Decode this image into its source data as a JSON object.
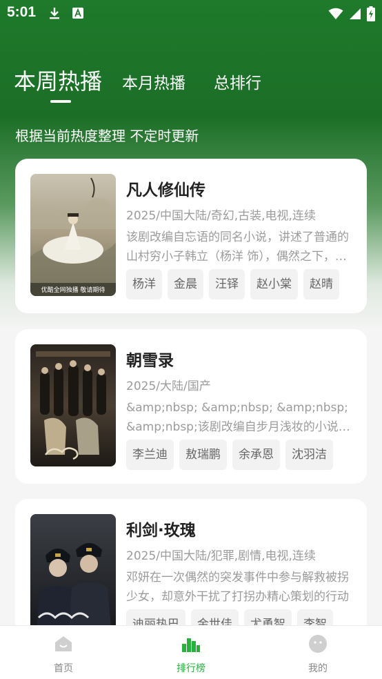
{
  "status_bar": {
    "time": "5:01",
    "left_icons": [
      "download-icon",
      "keyboard-a-icon"
    ],
    "right_icons": [
      "wifi-icon",
      "signal-icon",
      "battery-charging-icon"
    ]
  },
  "tabs": [
    {
      "label": "本周热播",
      "active": true
    },
    {
      "label": "本月热播",
      "active": false
    },
    {
      "label": "总排行",
      "active": false
    }
  ],
  "subtitle": "根据当前热度整理 不定时更新",
  "cards": [
    {
      "title": "凡人修仙传",
      "meta": "2025/中国大陆/奇幻,古装,电视,连续",
      "desc": "该剧改编自忘语的同名小说，讲述了普通的山村穷小子韩立（杨洋 饰），偶然之下，跨入到一个江湖小门派，虽然资质平庸，但依靠自身努力和合理算计最后修炼成仙的故事。",
      "tags": [
        "杨洋",
        "金晨",
        "汪铎",
        "赵小棠",
        "赵晴"
      ],
      "poster_caption": "优酷全网独播 敬请期待"
    },
    {
      "title": "朝雪录",
      "meta": "2025/大陆/国产",
      "desc": "&amp;nbsp; &amp;nbsp; &amp;nbsp; &amp;nbsp;该剧改编自步月浅妆的小说《仵作娇娘》",
      "tags": [
        "李兰迪",
        "敖瑞鹏",
        "余承恩",
        "沈羽洁"
      ],
      "poster_caption": ""
    },
    {
      "title": "利剑·玫瑰",
      "meta": "2025/中国大陆/犯罪,剧情,电视,连续",
      "desc": "邓妍在一次偶然的突发事件中参与解救被拐少女，却意外干扰了打拐办精心策划的行动",
      "tags": [
        "迪丽热巴",
        "金世佳",
        "尤勇智",
        "李智"
      ],
      "poster_caption": ""
    }
  ],
  "bottom_nav": [
    {
      "label": "首页",
      "icon": "home-icon",
      "active": false
    },
    {
      "label": "排行榜",
      "icon": "ranking-chart-icon",
      "active": true
    },
    {
      "label": "我的",
      "icon": "profile-face-icon",
      "active": false
    }
  ],
  "colors": {
    "header_green": "#1f7a2b",
    "active_green": "#27b23d",
    "inactive_gray": "#888888"
  }
}
